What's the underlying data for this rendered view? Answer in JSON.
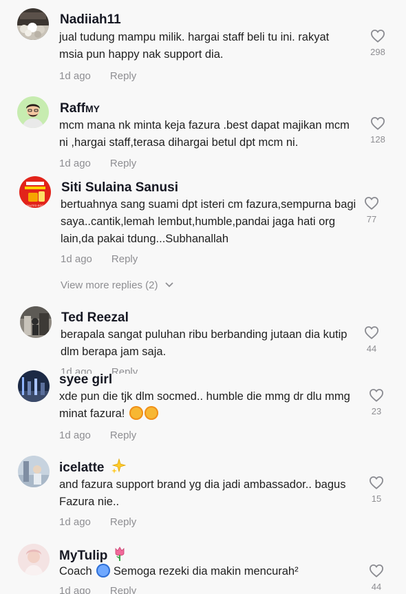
{
  "comments": [
    {
      "username": "Nadiiah11",
      "text": "jual tudung mampu milik. hargai staff beli tu ini. rakyat msia pun happy nak support dia.",
      "time": "1d ago",
      "reply": "Reply",
      "likes": "298"
    },
    {
      "username": "Raff",
      "username_suffix": "MY",
      "text": "mcm mana nk minta keja fazura .best dapat majikan mcm ni ,hargai staff,terasa dihargai betul dpt mcm ni.",
      "time": "1d ago",
      "reply": "Reply",
      "likes": "128"
    },
    {
      "username": "Siti Sulaina Sanusi",
      "text": "bertuahnya sang suami dpt isteri cm fazura,sempurna bagi saya..cantik,lemah lembut,humble,pandai jaga hati org lain,da pakai tdung...Subhanallah",
      "time": "1d ago",
      "reply": "Reply",
      "likes": "77",
      "avatar_text": "SALTED EGG CORNFLAKES"
    },
    {
      "username": "Ted Reezal",
      "text": "berapala sangat puluhan ribu berbanding jutaan dia kutip dlm berapa jam saja.",
      "time": "1d ago",
      "reply": "Reply",
      "likes": "44"
    },
    {
      "username": "syee girl",
      "text": "xde pun die tjk dlm socmed.. humble die mmg dr dlu mmg minat fazura!",
      "time": "1d ago",
      "reply": "Reply",
      "likes": "23"
    },
    {
      "username": "icelatte",
      "text": "and fazura support brand yg dia jadi ambassador.. bagus Fazura nie..",
      "time": "1d ago",
      "reply": "Reply",
      "likes": "15"
    },
    {
      "username": "MyTulip",
      "text_before": "Coach",
      "text_after": "Semoga rezeki dia makin mencurah²",
      "time": "1d ago",
      "reply": "Reply",
      "likes": "44"
    }
  ],
  "view_more_replies": "View more replies (2)",
  "icons": {
    "like": "heart-outline-icon",
    "expand": "chevron-down-icon",
    "sparkle": "sparkles-emoji",
    "tulip": "tulip-emoji",
    "smiling": "smiling-hearts-emoji",
    "scream": "screaming-face-emoji"
  },
  "colors": {
    "text": "#161823",
    "muted": "#8e8e92",
    "background": "#f8f8f8"
  }
}
